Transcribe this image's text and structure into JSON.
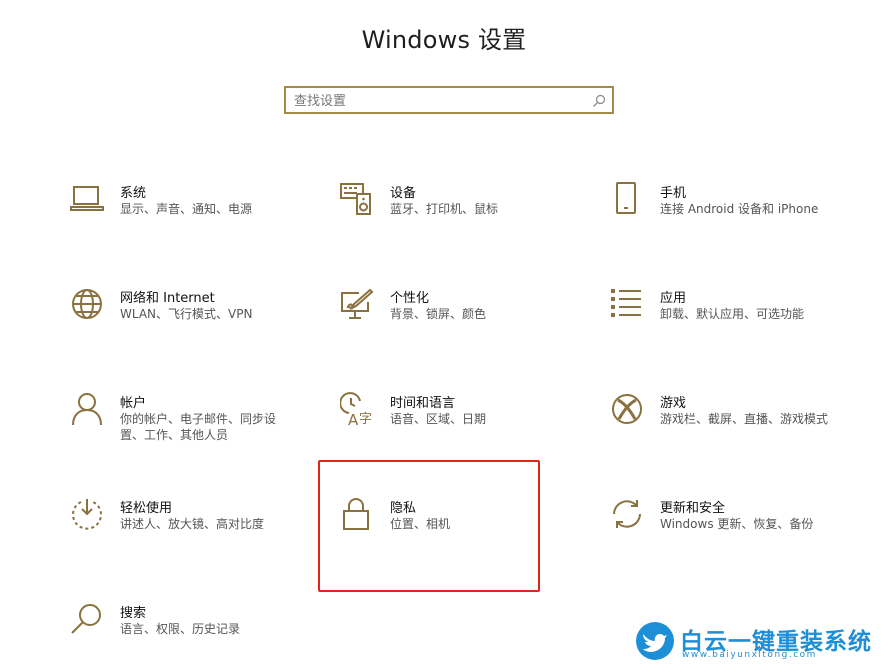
{
  "header": {
    "title": "Windows 设置"
  },
  "search": {
    "placeholder": "查找设置"
  },
  "tiles": [
    {
      "title": "系统",
      "subtitle": "显示、声音、通知、电源",
      "icon": "laptop-icon"
    },
    {
      "title": "设备",
      "subtitle": "蓝牙、打印机、鼠标",
      "icon": "keyboard-speaker-icon"
    },
    {
      "title": "手机",
      "subtitle": "连接 Android 设备和 iPhone",
      "icon": "phone-icon"
    },
    {
      "title": "网络和 Internet",
      "subtitle": "WLAN、飞行模式、VPN",
      "icon": "globe-icon"
    },
    {
      "title": "个性化",
      "subtitle": "背景、锁屏、颜色",
      "icon": "paint-brush-icon"
    },
    {
      "title": "应用",
      "subtitle": "卸载、默认应用、可选功能",
      "icon": "apps-list-icon"
    },
    {
      "title": "帐户",
      "subtitle": "你的帐户、电子邮件、同步设置、工作、其他人员",
      "icon": "person-icon"
    },
    {
      "title": "时间和语言",
      "subtitle": "语音、区域、日期",
      "icon": "time-language-icon"
    },
    {
      "title": "游戏",
      "subtitle": "游戏栏、截屏、直播、游戏模式",
      "icon": "xbox-icon"
    },
    {
      "title": "轻松使用",
      "subtitle": "讲述人、放大镜、高对比度",
      "icon": "ease-of-access-icon"
    },
    {
      "title": "隐私",
      "subtitle": "位置、相机",
      "icon": "lock-icon"
    },
    {
      "title": "更新和安全",
      "subtitle": "Windows 更新、恢复、备份",
      "icon": "sync-icon"
    },
    {
      "title": "搜索",
      "subtitle": "语言、权限、历史记录",
      "icon": "search-icon"
    }
  ],
  "watermark": {
    "name": "白云一键重装系统",
    "url": "www.baiyunxitong.com"
  },
  "colors": {
    "accent": "#a58a4a",
    "highlight": "#e3241b",
    "watermark": "#1e8fd6"
  }
}
